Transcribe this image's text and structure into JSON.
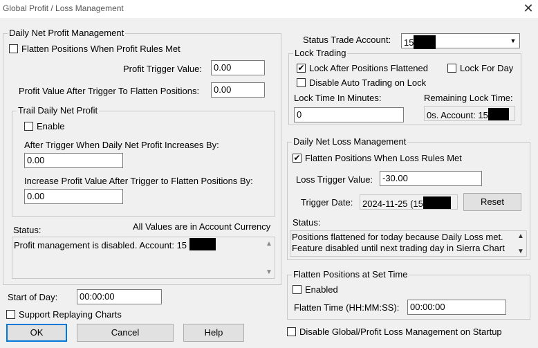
{
  "window": {
    "title": "Global Profit / Loss Management",
    "close_glyph": "✕"
  },
  "profit": {
    "legend": "Daily Net Profit Management",
    "flatten_label": "Flatten Positions When Profit Rules Met",
    "flatten_checked": false,
    "trigger_label": "Profit Trigger Value:",
    "trigger_value": "0.00",
    "after_trigger_label": "Profit Value After Trigger To Flatten Positions:",
    "after_trigger_value": "0.00",
    "trail": {
      "legend": "Trail Daily Net Profit",
      "enable_label": "Enable",
      "enable_checked": false,
      "increase_label": "After Trigger When Daily Net Profit Increases By:",
      "increase_value": "0.00",
      "increase_after_label": "Increase Profit Value After Trigger to Flatten Positions By:",
      "increase_after_value": "0.00"
    },
    "status_label": "Status:",
    "currency_note": "All Values are in Account Currency",
    "status_text": "Profit management is disabled. Account: 15"
  },
  "start_of_day": {
    "label": "Start of Day:",
    "value": "00:00:00"
  },
  "support_replay": {
    "label": "Support Replaying Charts",
    "checked": false
  },
  "buttons": {
    "ok": "OK",
    "cancel": "Cancel",
    "help": "Help"
  },
  "status_account": {
    "label": "Status Trade Account:",
    "value": "15"
  },
  "lock": {
    "legend": "Lock Trading",
    "after_flatten_label": "Lock After Positions Flattened",
    "after_flatten_checked": true,
    "for_day_label": "Lock For Day",
    "for_day_checked": false,
    "disable_auto_label": "Disable Auto Trading on Lock",
    "disable_auto_checked": false,
    "time_label": "Lock Time In Minutes:",
    "time_value": "0",
    "remaining_label": "Remaining Lock Time:",
    "remaining_value": "0s. Account: 15"
  },
  "loss": {
    "legend": "Daily Net Loss Management",
    "flatten_label": "Flatten Positions When Loss Rules Met",
    "flatten_checked": true,
    "trigger_label": "Loss Trigger Value:",
    "trigger_value": "-30.00",
    "date_label": "Trigger Date:",
    "date_value": "2024-11-25 (15",
    "reset_label": "Reset",
    "status_label": "Status:",
    "status_line1": "Positions flattened for today because Daily Loss met.",
    "status_line2": "Feature disabled until next trading day in Sierra Chart"
  },
  "flatten_time": {
    "legend": "Flatten Positions at Set Time",
    "enabled_label": "Enabled",
    "enabled_checked": false,
    "time_label": "Flatten Time (HH:MM:SS):",
    "time_value": "00:00:00"
  },
  "disable_startup": {
    "label": "Disable Global/Profit Loss Management on Startup",
    "checked": false
  },
  "checkmark_glyph": "✔",
  "dropdown_glyph": "▼",
  "scroll_up_glyph": "▲",
  "scroll_down_glyph": "▼"
}
